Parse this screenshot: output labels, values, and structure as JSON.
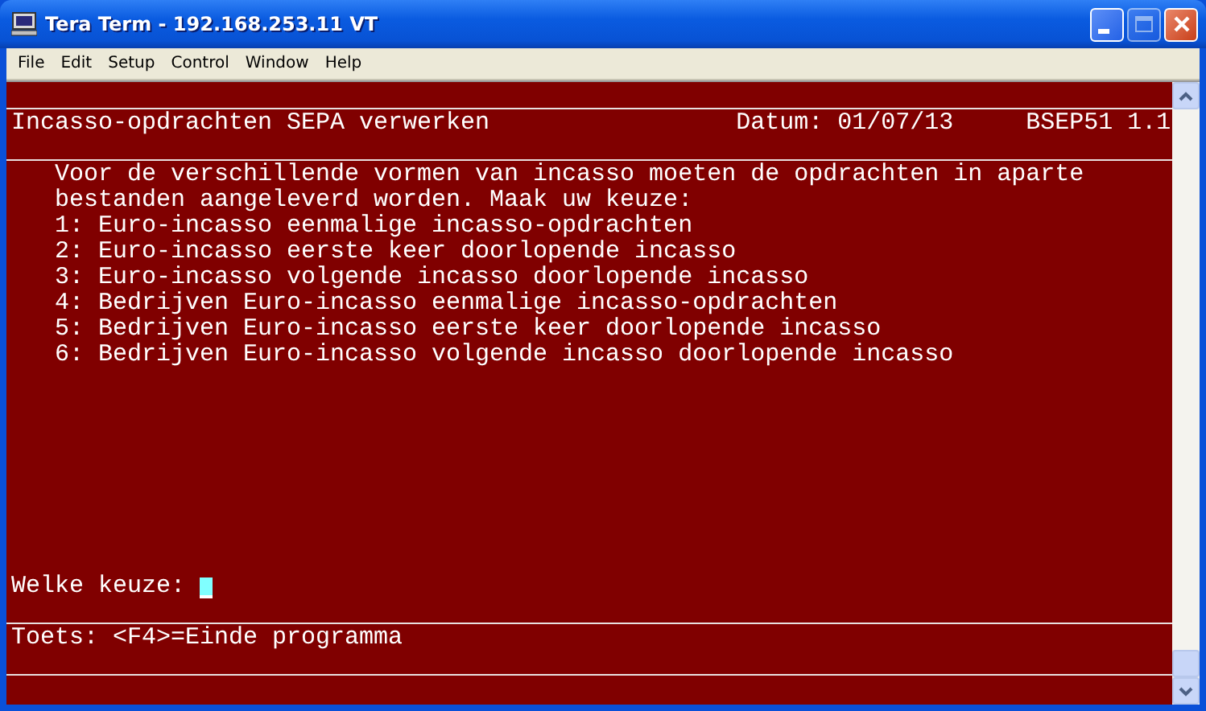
{
  "window": {
    "title": "Tera Term - 192.168.253.11 VT",
    "controls": [
      {
        "kind": "minimize",
        "disabled": false
      },
      {
        "kind": "maximize",
        "disabled": true
      },
      {
        "kind": "close",
        "disabled": false
      }
    ]
  },
  "menu": [
    {
      "label": "File"
    },
    {
      "label": "Edit"
    },
    {
      "label": "Setup"
    },
    {
      "label": "Control"
    },
    {
      "label": "Window"
    },
    {
      "label": "Help"
    }
  ],
  "terminal": {
    "header": {
      "title": "Incasso-opdrachten SEPA verwerken",
      "date": "Datum: 01/07/13",
      "program": "BSEP51 1.1"
    },
    "lines": [
      "Voor de verschillende vormen van incasso moeten de opdrachten in aparte",
      "bestanden aangeleverd worden. Maak uw keuze:",
      "1: Euro-incasso eenmalige incasso-opdrachten",
      "2: Euro-incasso eerste keer doorlopende incasso",
      "3: Euro-incasso volgende incasso doorlopende incasso",
      "4: Bedrijven Euro-incasso eenmalige incasso-opdrachten",
      "5: Bedrijven Euro-incasso eerste keer doorlopende incasso",
      "6: Bedrijven Euro-incasso volgende incasso doorlopende incasso"
    ],
    "prompt": "Welke keuze:",
    "footer": "Toets: <F4>=Einde programma"
  }
}
